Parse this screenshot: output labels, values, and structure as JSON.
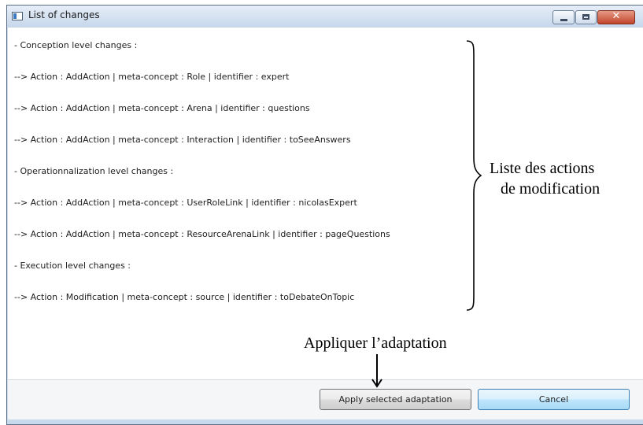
{
  "window": {
    "title": "List of changes",
    "close_glyph": "✕"
  },
  "changes": [
    "- Conception level changes :",
    "--> Action : AddAction | meta-concept : Role | identifier : expert",
    "--> Action : AddAction | meta-concept : Arena | identifier : questions",
    "--> Action : AddAction | meta-concept : Interaction | identifier : toSeeAnswers",
    "- Operationnalization level changes :",
    "--> Action : AddAction | meta-concept : UserRoleLink | identifier : nicolasExpert",
    "--> Action : AddAction | meta-concept : ResourceArenaLink | identifier : pageQuestions",
    "- Execution level changes :",
    "--> Action : Modification | meta-concept : source | identifier : toDebateOnTopic"
  ],
  "buttons": {
    "apply": "Apply selected adaptation",
    "cancel": "Cancel"
  },
  "annotations": {
    "brace_label_line1": "Liste des actions",
    "brace_label_line2": "de modification",
    "arrow_label": "Appliquer l’adaptation"
  },
  "icons": [
    "app-window-icon",
    "minimize-icon",
    "maximize-icon",
    "close-icon",
    "curly-brace-annotation",
    "down-arrow-annotation"
  ],
  "colors": {
    "titlebar": "#c6d6ea",
    "close_button": "#c2452b",
    "cancel_button": "#bee6fd"
  }
}
